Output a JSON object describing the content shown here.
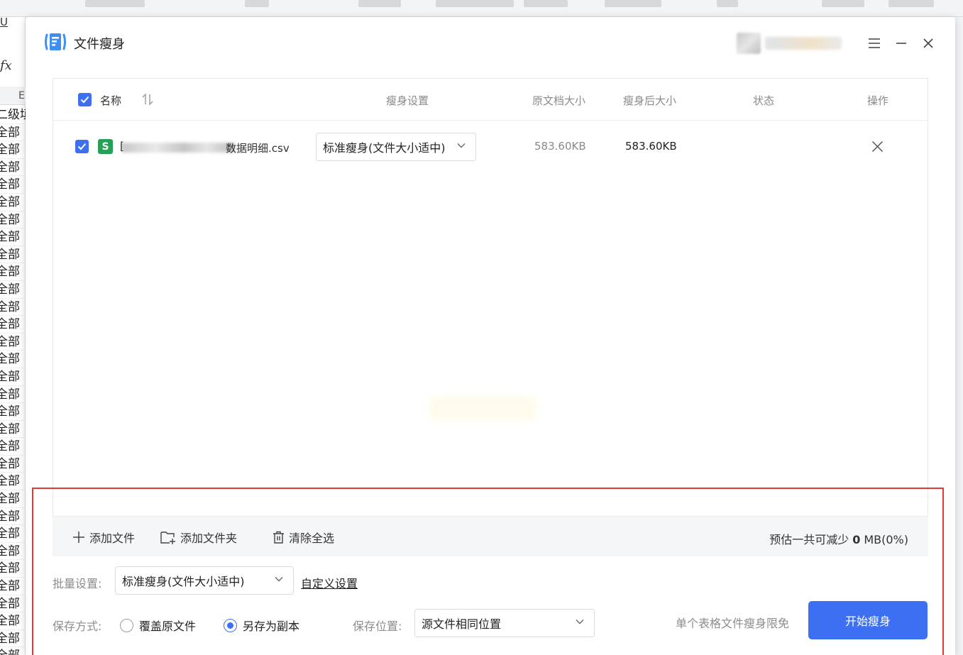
{
  "background": {
    "formula_icon": "fx",
    "underline_icon": "U",
    "column_letter": "E",
    "first_row_text": "二级填",
    "cells": [
      "全部",
      "全部",
      "全部",
      "全部",
      "全部",
      "全部",
      "全部",
      "全部",
      "全部",
      "全部",
      "全部",
      "全部",
      "全部",
      "全部",
      "全部",
      "全部",
      "全部",
      "全部",
      "全部",
      "全部",
      "全部",
      "全部",
      "全部",
      "全部",
      "全部",
      "全部",
      "全部",
      "全部",
      "全部",
      "全部",
      "全部"
    ]
  },
  "dialog": {
    "title": "文件瘦身",
    "window_controls": [
      "menu-icon",
      "minimize-icon",
      "close-icon"
    ]
  },
  "table": {
    "columns": {
      "name": "名称",
      "slim_setting": "瘦身设置",
      "original_size": "原文档大小",
      "slimmed_size": "瘦身后大小",
      "status": "状态",
      "action": "操作"
    },
    "rows": [
      {
        "checked": true,
        "file_type_badge": "S",
        "name_prefix": "[",
        "name_suffix": "数据明细.csv",
        "slim_option": "标准瘦身(文件大小适中)",
        "original_size": "583.60KB",
        "slimmed_size": "583.60KB",
        "status": ""
      }
    ]
  },
  "actions": {
    "add_file": "添加文件",
    "add_folder": "添加文件夹",
    "clear_all": "清除全选",
    "estimate_prefix": "预估一共可减少",
    "estimate_value": "0",
    "estimate_unit": "MB(0%)"
  },
  "settings": {
    "batch_label": "批量设置:",
    "batch_value": "标准瘦身(文件大小适中)",
    "custom_link": "自定义设置",
    "save_mode_label": "保存方式:",
    "save_mode_options": [
      "覆盖原文件",
      "另存为副本"
    ],
    "save_mode_selected": "另存为副本",
    "save_location_label": "保存位置:",
    "save_location_value": "源文件相同位置",
    "limit_text": "单个表格文件瘦身限免",
    "start_button": "开始瘦身"
  },
  "colors": {
    "accent": "#3d6ff2",
    "file_badge": "#24a155",
    "highlight_frame": "#e53935"
  }
}
